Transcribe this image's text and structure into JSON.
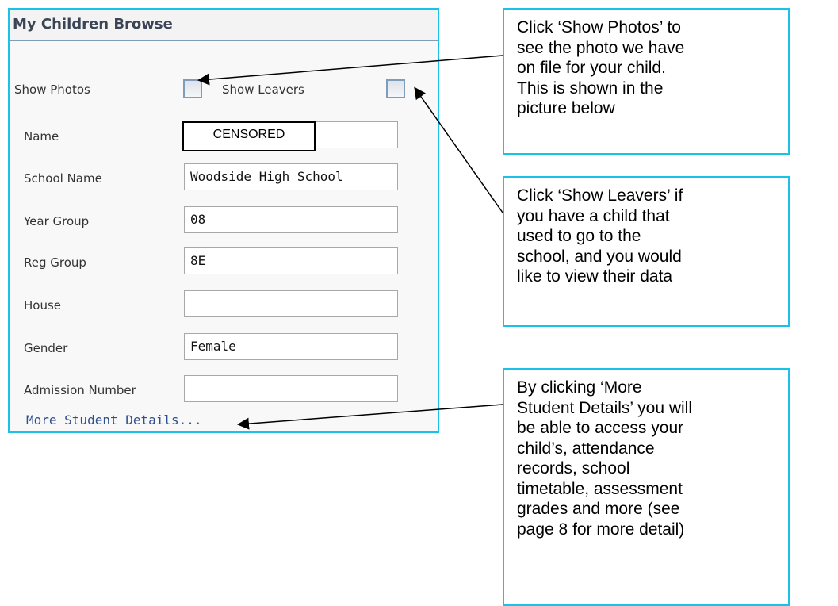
{
  "panel": {
    "title": "My Children Browse",
    "show_photos_label": "Show Photos",
    "show_leavers_label": "Show Leavers",
    "fields": [
      {
        "label": "Name",
        "value": ""
      },
      {
        "label": "School Name",
        "value": "Woodside High School"
      },
      {
        "label": "Year Group",
        "value": "08"
      },
      {
        "label": "Reg Group",
        "value": "8E"
      },
      {
        "label": "House",
        "value": ""
      },
      {
        "label": "Gender",
        "value": "Female"
      },
      {
        "label": "Admission Number",
        "value": ""
      }
    ],
    "censor_text": "CENSORED",
    "more_details_link": "More Student Details..."
  },
  "callouts": {
    "photos": [
      "Click ‘Show Photos’ to",
      "see the photo we have",
      "on file for your child.",
      "This is shown in the",
      "picture below"
    ],
    "leavers": [
      "Click ‘Show Leavers’ if",
      "you have a child that",
      "used to go to the",
      "school, and you would",
      "like to view their data"
    ],
    "details": [
      "By clicking ‘More",
      "Student Details’ you will",
      "be able to access your",
      "child’s, attendance",
      "records, school",
      "timetable, assessment",
      "grades and more (see",
      "page 8 for more detail)"
    ]
  },
  "colors": {
    "panel_border": "#19c2e6",
    "link": "#2f4f8f",
    "title": "#3b4454"
  }
}
